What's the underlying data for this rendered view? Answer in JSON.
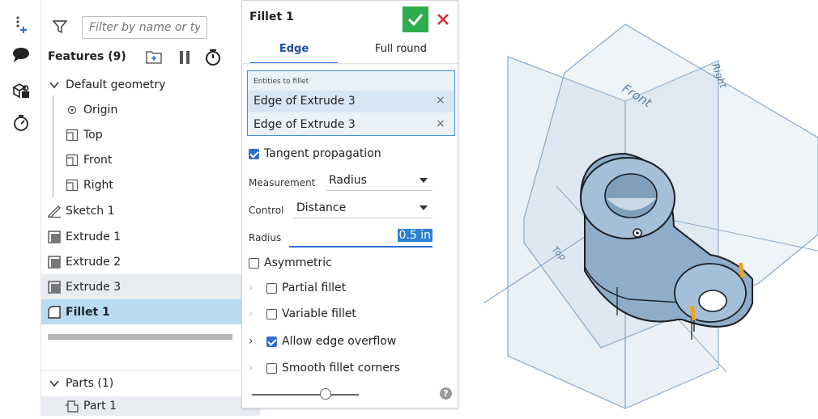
{
  "toolbar": {
    "icons": [
      "insert-feature-icon",
      "comment-icon",
      "parts-icon",
      "timer-icon"
    ]
  },
  "features": {
    "filter_placeholder": "Filter by name or type",
    "header": "Features (9)",
    "items": [
      {
        "label": "Default geometry",
        "type": "group"
      },
      {
        "label": "Origin",
        "type": "origin"
      },
      {
        "label": "Top",
        "type": "plane"
      },
      {
        "label": "Front",
        "type": "plane"
      },
      {
        "label": "Right",
        "type": "plane"
      },
      {
        "label": "Sketch 1",
        "type": "sketch"
      },
      {
        "label": "Extrude 1",
        "type": "extrude"
      },
      {
        "label": "Extrude 2",
        "type": "extrude"
      },
      {
        "label": "Extrude 3",
        "type": "extrude"
      },
      {
        "label": "Fillet 1",
        "type": "fillet"
      }
    ],
    "parts_header": "Parts (1)",
    "parts": [
      {
        "label": "Part 1"
      }
    ]
  },
  "dialog": {
    "title": "Fillet 1",
    "tabs": [
      {
        "label": "Edge"
      },
      {
        "label": "Full round"
      }
    ],
    "entities_label": "Entities to fillet",
    "entities": [
      {
        "label": "Edge of Extrude 3"
      },
      {
        "label": "Edge of Extrude 3"
      }
    ],
    "tangent_propagation": "Tangent propagation",
    "measurement_label": "Measurement",
    "measurement_value": "Radius",
    "control_label": "Control",
    "control_value": "Distance",
    "radius_label": "Radius",
    "radius_value": "0.5 in",
    "asymmetric": "Asymmetric",
    "partial_fillet": "Partial fillet",
    "variable_fillet": "Variable fillet",
    "allow_edge_overflow": "Allow edge overflow",
    "smooth_corners": "Smooth fillet corners",
    "help": "?"
  },
  "viewport": {
    "plane_labels": {
      "front": "Front",
      "right": "Right",
      "top": "Top"
    }
  },
  "colors": {
    "accent": "#2e6fd1",
    "ok_green": "#2eae4e",
    "cancel_red": "#d0312d",
    "selection_blue": "#b9dcf3",
    "plane_blue": "#b7cde2",
    "part_blue": "#9db7cf"
  }
}
